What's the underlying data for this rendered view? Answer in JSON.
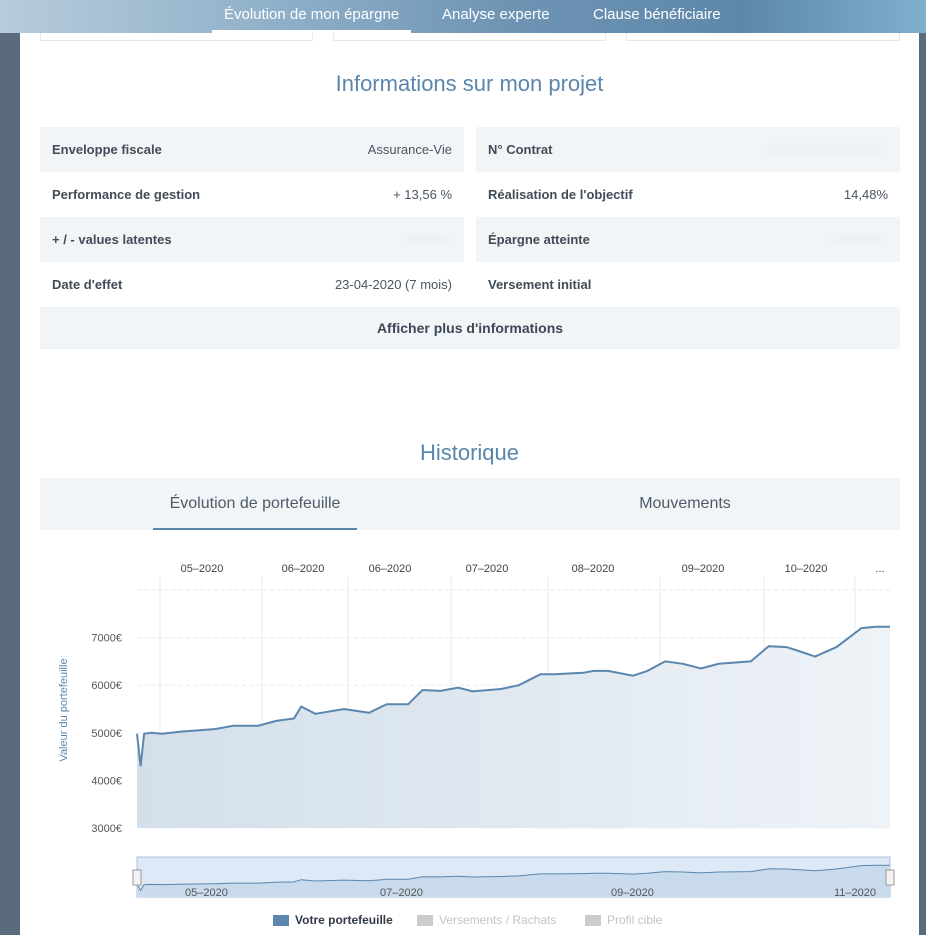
{
  "tabs": [
    {
      "label": "Évolution de mon épargne",
      "active": true
    },
    {
      "label": "Analyse experte",
      "active": false
    },
    {
      "label": "Clause bénéficiaire",
      "active": false
    }
  ],
  "project": {
    "title": "Informations sur mon projet",
    "rows": [
      {
        "label": "Enveloppe fiscale",
        "value": "Assurance-Vie"
      },
      {
        "label": "N° Contrat",
        "value": ""
      },
      {
        "label": "Performance de gestion",
        "value": "+ 13,56 %"
      },
      {
        "label": "Réalisation de l'objectif",
        "value": "14,48%"
      },
      {
        "label": "+ / - values latentes",
        "value": ""
      },
      {
        "label": "Épargne atteinte",
        "value": ""
      },
      {
        "label": "Date d'effet",
        "value": "23-04-2020 (7 mois)"
      },
      {
        "label": "Versement initial",
        "value": ""
      }
    ],
    "more_button": "Afficher plus d'informations"
  },
  "history": {
    "title": "Historique",
    "tabs": [
      {
        "label": "Évolution de portefeuille",
        "active": true
      },
      {
        "label": "Mouvements",
        "active": false
      }
    ]
  },
  "colors": {
    "accent": "#5a86ad",
    "line": "#5b86ad",
    "area": "#dce6ef"
  },
  "chart_data": {
    "type": "area",
    "ylabel": "Valeur du portefeuille",
    "y_ticks": [
      "3000€",
      "4000€",
      "5000€",
      "6000€",
      "7000€"
    ],
    "ylim": [
      3000,
      8000
    ],
    "x_top_ticks": [
      "05–2020",
      "06–2020",
      "06–2020",
      "07–2020",
      "08–2020",
      "09–2020",
      "10–2020",
      "..."
    ],
    "navigator_ticks": [
      "05–2020",
      "07–2020",
      "09–2020",
      "11–2020"
    ],
    "x_range": [
      "2020-04-23",
      "2020-11-20"
    ],
    "series": [
      {
        "name": "Votre portefeuille",
        "x": [
          "2020-04-23",
          "2020-04-24",
          "2020-04-25",
          "2020-04-27",
          "2020-04-30",
          "2020-05-05",
          "2020-05-10",
          "2020-05-15",
          "2020-05-20",
          "2020-05-27",
          "2020-06-01",
          "2020-06-06",
          "2020-06-08",
          "2020-06-12",
          "2020-06-20",
          "2020-06-27",
          "2020-07-02",
          "2020-07-08",
          "2020-07-12",
          "2020-07-17",
          "2020-07-22",
          "2020-07-26",
          "2020-08-03",
          "2020-08-08",
          "2020-08-14",
          "2020-08-18",
          "2020-08-26",
          "2020-08-29",
          "2020-09-02",
          "2020-09-09",
          "2020-09-13",
          "2020-09-18",
          "2020-09-23",
          "2020-09-28",
          "2020-10-03",
          "2020-10-12",
          "2020-10-17",
          "2020-10-22",
          "2020-10-25",
          "2020-10-30",
          "2020-11-05",
          "2020-11-12",
          "2020-11-16",
          "2020-11-20"
        ],
        "values": [
          4980,
          4300,
          4980,
          5000,
          4980,
          5020,
          5050,
          5080,
          5150,
          5150,
          5250,
          5300,
          5550,
          5400,
          5500,
          5420,
          5600,
          5600,
          5900,
          5880,
          5950,
          5870,
          5920,
          6000,
          6230,
          6230,
          6260,
          6300,
          6300,
          6200,
          6300,
          6500,
          6450,
          6350,
          6450,
          6500,
          6820,
          6800,
          6730,
          6600,
          6800,
          7200,
          7230,
          7230
        ]
      }
    ],
    "legend": [
      {
        "name": "Votre portefeuille",
        "color": "#5b86ad",
        "active": true
      },
      {
        "name": "Versements / Rachats",
        "color": "#cccccc",
        "active": false
      },
      {
        "name": "Profil cible",
        "color": "#cccccc",
        "active": false
      }
    ]
  }
}
